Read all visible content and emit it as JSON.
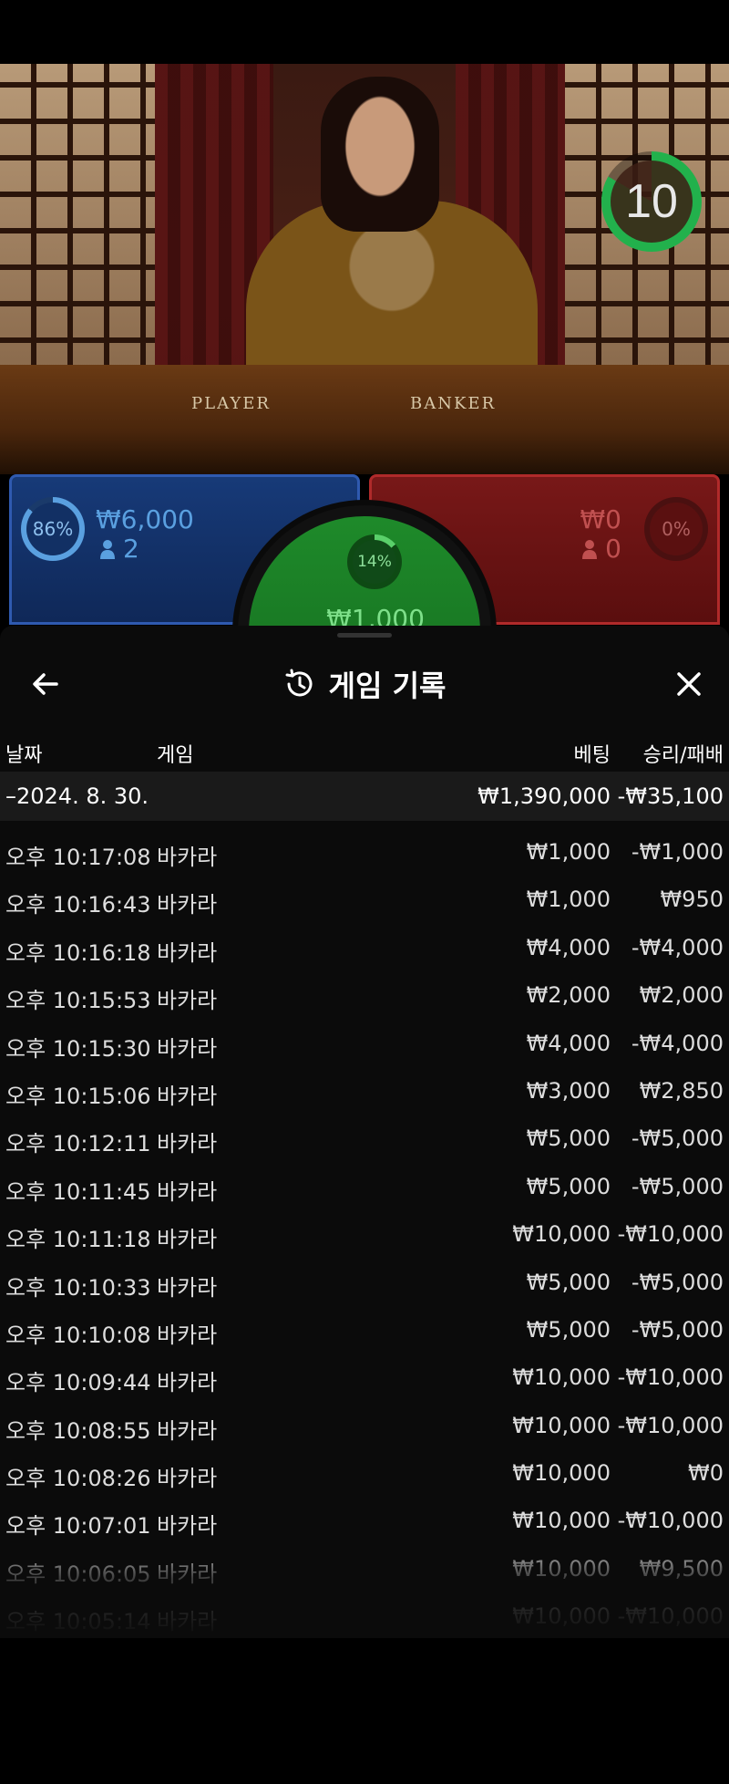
{
  "video": {
    "timer_value": "10",
    "timer_progress": 0.83,
    "table_labels": [
      "PLAYER",
      "BANKER"
    ]
  },
  "bet_panels": {
    "player": {
      "percent": "86%",
      "amount": "₩6,000",
      "players": "2",
      "color": "#173a78"
    },
    "tie": {
      "percent": "14%",
      "amount": "₩1,000",
      "color": "#1e8a2a"
    },
    "banker": {
      "percent": "0%",
      "amount": "₩0",
      "players": "0",
      "color": "#781818"
    }
  },
  "sheet": {
    "title": "게임 기록",
    "columns": {
      "date": "날짜",
      "game": "게임",
      "bet": "베팅",
      "result": "승리/패배"
    },
    "date_group": {
      "label": "–2024. 8. 30.",
      "bet_total": "₩1,390,000",
      "result_total": "-₩35,100"
    },
    "rows": [
      {
        "time": "오후 10:17:08",
        "game": "바카라",
        "bet": "₩1,000",
        "result": "-₩1,000"
      },
      {
        "time": "오후 10:16:43",
        "game": "바카라",
        "bet": "₩1,000",
        "result": "₩950"
      },
      {
        "time": "오후 10:16:18",
        "game": "바카라",
        "bet": "₩4,000",
        "result": "-₩4,000"
      },
      {
        "time": "오후 10:15:53",
        "game": "바카라",
        "bet": "₩2,000",
        "result": "₩2,000"
      },
      {
        "time": "오후 10:15:30",
        "game": "바카라",
        "bet": "₩4,000",
        "result": "-₩4,000"
      },
      {
        "time": "오후 10:15:06",
        "game": "바카라",
        "bet": "₩3,000",
        "result": "₩2,850"
      },
      {
        "time": "오후 10:12:11",
        "game": "바카라",
        "bet": "₩5,000",
        "result": "-₩5,000"
      },
      {
        "time": "오후 10:11:45",
        "game": "바카라",
        "bet": "₩5,000",
        "result": "-₩5,000"
      },
      {
        "time": "오후 10:11:18",
        "game": "바카라",
        "bet": "₩10,000",
        "result": "-₩10,000"
      },
      {
        "time": "오후 10:10:33",
        "game": "바카라",
        "bet": "₩5,000",
        "result": "-₩5,000"
      },
      {
        "time": "오후 10:10:08",
        "game": "바카라",
        "bet": "₩5,000",
        "result": "-₩5,000"
      },
      {
        "time": "오후 10:09:44",
        "game": "바카라",
        "bet": "₩10,000",
        "result": "-₩10,000"
      },
      {
        "time": "오후 10:08:55",
        "game": "바카라",
        "bet": "₩10,000",
        "result": "-₩10,000"
      },
      {
        "time": "오후 10:08:26",
        "game": "바카라",
        "bet": "₩10,000",
        "result": "₩0"
      },
      {
        "time": "오후 10:07:01",
        "game": "바카라",
        "bet": "₩10,000",
        "result": "-₩10,000"
      },
      {
        "time": "오후 10:06:05",
        "game": "바카라",
        "bet": "₩10,000",
        "result": "₩9,500"
      },
      {
        "time": "오후 10:05:14",
        "game": "바카라",
        "bet": "₩10,000",
        "result": "-₩10,000"
      }
    ]
  },
  "icons": {
    "back": "arrow-left-icon",
    "history": "history-clock-icon",
    "close": "close-icon"
  }
}
